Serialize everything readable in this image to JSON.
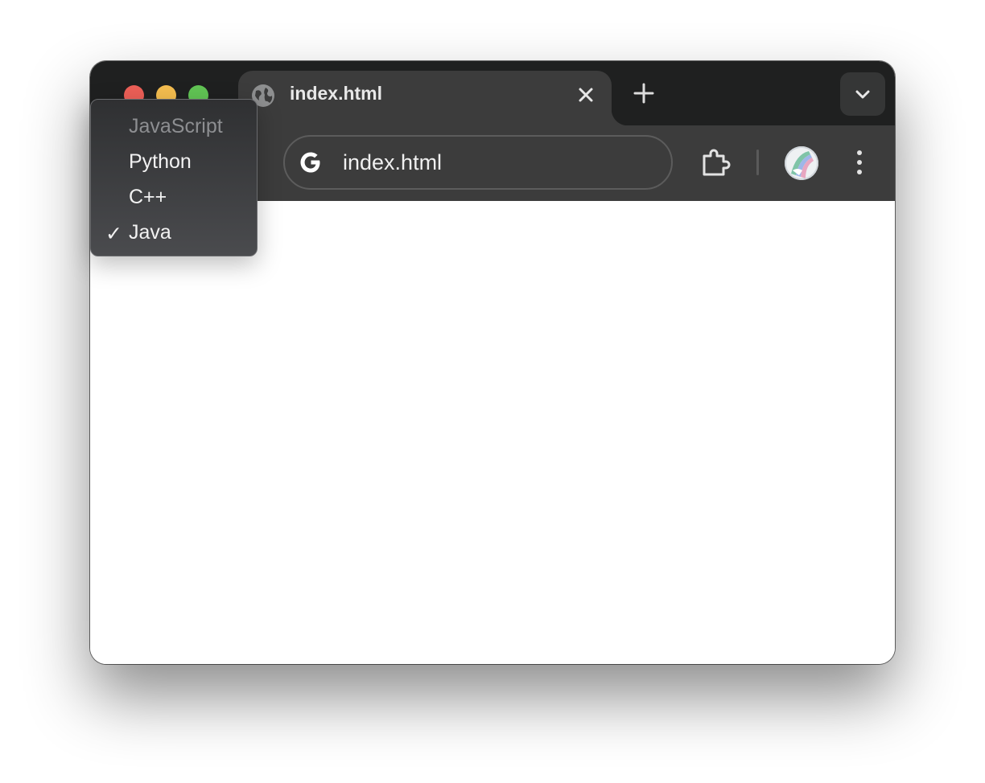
{
  "browser": {
    "tab": {
      "title": "index.html"
    },
    "address_bar": {
      "url": "index.html"
    }
  },
  "dropdown": {
    "options": [
      {
        "label": "JavaScript",
        "disabled": true,
        "selected": false
      },
      {
        "label": "Python",
        "disabled": false,
        "selected": false
      },
      {
        "label": "C++",
        "disabled": false,
        "selected": false
      },
      {
        "label": "Java",
        "disabled": false,
        "selected": true
      }
    ],
    "check_glyph": "✓"
  },
  "colors": {
    "titlebar": "#1f2020",
    "toolbar": "#3c3c3c",
    "close": "#ec5f57",
    "minimize": "#f4bd4f",
    "zoom": "#61c454"
  }
}
